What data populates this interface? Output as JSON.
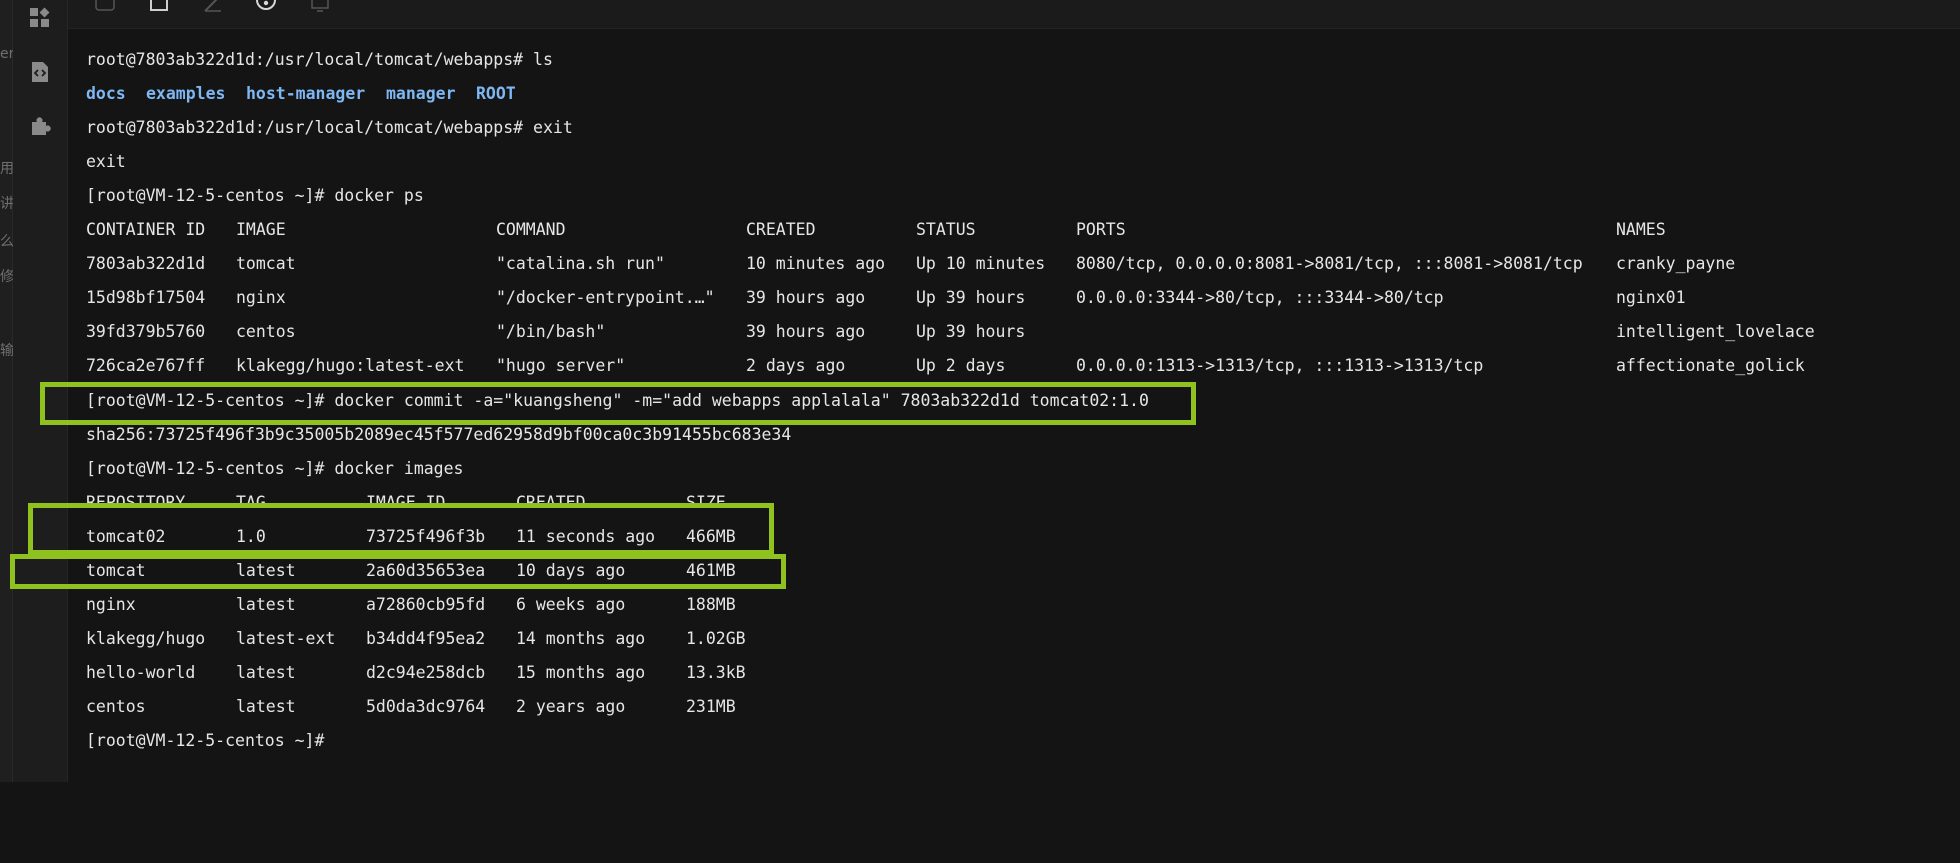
{
  "left_edge": {
    "chars": [
      "er",
      "用",
      "讲",
      "么",
      "修",
      "输"
    ]
  },
  "terminal": {
    "ls_prompt": "root@7803ab322d1d:/usr/local/tomcat/webapps# ls",
    "ls_output": [
      "docs",
      "examples",
      "host-manager",
      "manager",
      "ROOT"
    ],
    "exit_prompt": "root@7803ab322d1d:/usr/local/tomcat/webapps# exit",
    "exit_output": "exit",
    "ps_prompt": "[root@VM-12-5-centos ~]# docker ps",
    "ps_headers": [
      "CONTAINER ID",
      "IMAGE",
      "COMMAND",
      "CREATED",
      "STATUS",
      "PORTS",
      "NAMES"
    ],
    "ps_rows": [
      [
        "7803ab322d1d",
        "tomcat",
        "\"catalina.sh run\"",
        "10 minutes ago",
        "Up 10 minutes",
        "8080/tcp, 0.0.0.0:8081->8081/tcp, :::8081->8081/tcp",
        "cranky_payne"
      ],
      [
        "15d98bf17504",
        "nginx",
        "\"/docker-entrypoint.…\"",
        "39 hours ago",
        "Up 39 hours",
        "0.0.0.0:3344->80/tcp, :::3344->80/tcp",
        "nginx01"
      ],
      [
        "39fd379b5760",
        "centos",
        "\"/bin/bash\"",
        "39 hours ago",
        "Up 39 hours",
        "",
        "intelligent_lovelace"
      ],
      [
        "726ca2e767ff",
        "klakegg/hugo:latest-ext",
        "\"hugo server\"",
        "2 days ago",
        "Up 2 days",
        "0.0.0.0:1313->1313/tcp, :::1313->1313/tcp",
        "affectionate_golick"
      ]
    ],
    "commit_prompt": "[root@VM-12-5-centos ~]# docker commit -a=\"kuangsheng\" -m=\"add webapps applalala\" 7803ab322d1d tomcat02:1.0",
    "commit_output": "sha256:73725f496f3b9c35005b2089ec45f577ed62958d9bf00ca0c3b91455bc683e34",
    "images_prompt": "[root@VM-12-5-centos ~]# docker images",
    "images_headers": [
      "REPOSITORY",
      "TAG",
      "IMAGE ID",
      "CREATED",
      "SIZE"
    ],
    "images_rows": [
      [
        "tomcat02",
        "1.0",
        "73725f496f3b",
        "11 seconds ago",
        "466MB"
      ],
      [
        "tomcat",
        "latest",
        "2a60d35653ea",
        "10 days ago",
        "461MB"
      ],
      [
        "nginx",
        "latest",
        "a72860cb95fd",
        "6 weeks ago",
        "188MB"
      ],
      [
        "klakegg/hugo",
        "latest-ext",
        "b34dd4f95ea2",
        "14 months ago",
        "1.02GB"
      ],
      [
        "hello-world",
        "latest",
        "d2c94e258dcb",
        "15 months ago",
        "13.3kB"
      ],
      [
        "centos",
        "latest",
        "5d0da3dc9764",
        "2 years ago",
        "231MB"
      ]
    ],
    "final_prompt": "[root@VM-12-5-centos ~]#"
  },
  "colors": {
    "background": "#141414",
    "text": "#e6e6e6",
    "directory": "#7eb7f3",
    "highlight": "#8fc21f"
  },
  "icons": {
    "sidebar": [
      "dashboard-icon",
      "code-file-icon",
      "puzzle-icon"
    ],
    "toolbar": [
      "code-icon",
      "square-icon",
      "pen-icon",
      "clock-icon",
      "monitor-icon"
    ]
  }
}
